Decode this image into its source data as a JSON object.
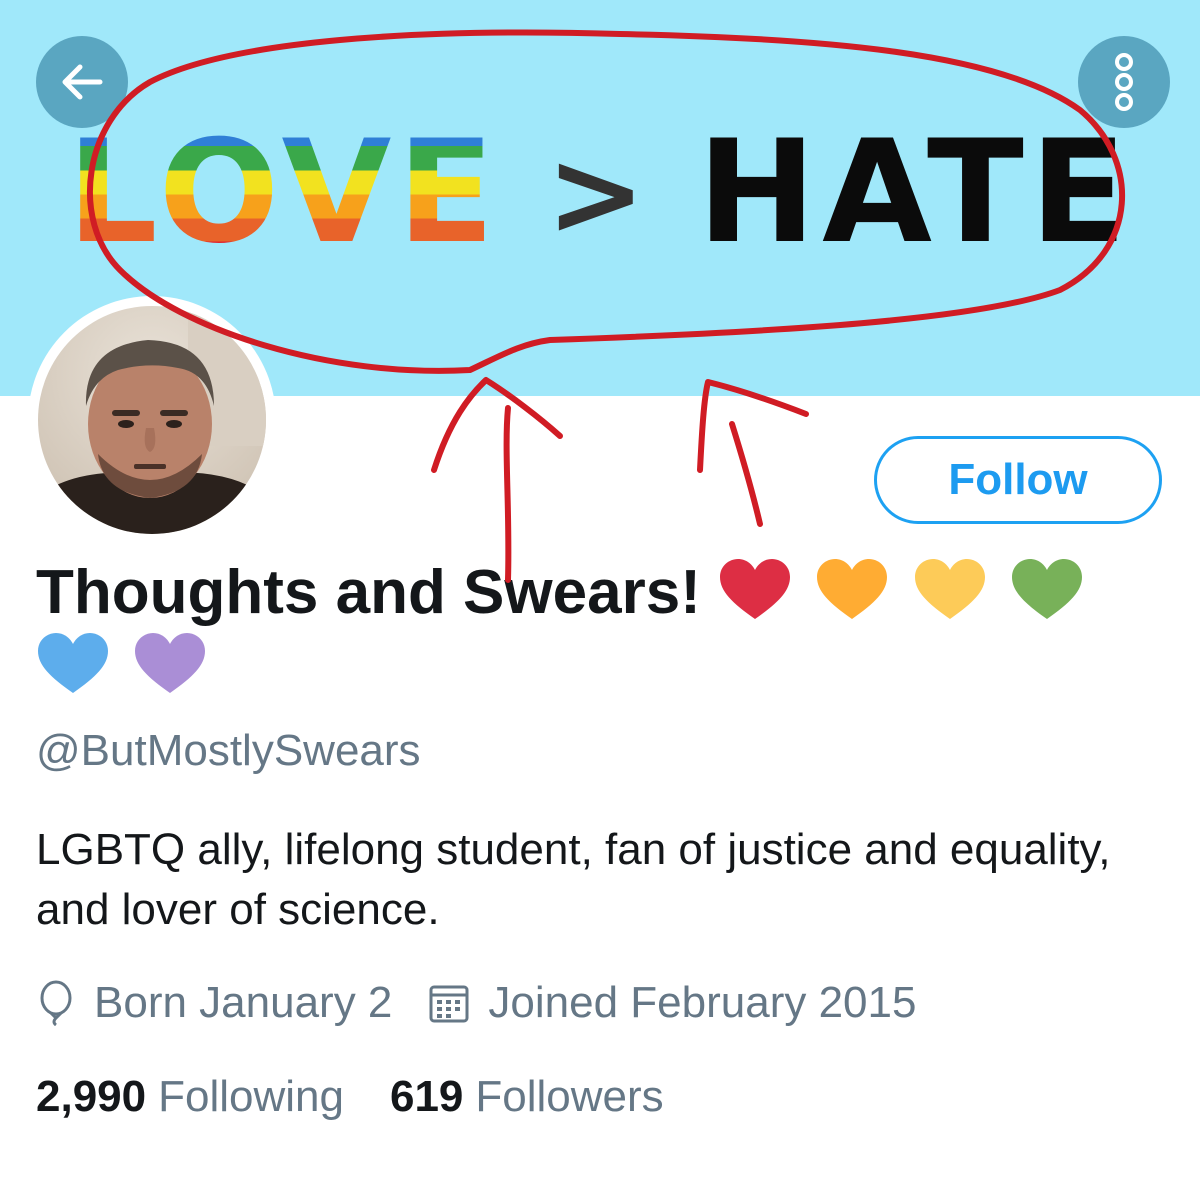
{
  "banner": {
    "word_love": "LOVE",
    "symbol": ">",
    "word_hate": "HATE",
    "background": "#a0e8fa"
  },
  "nav": {
    "back_icon": "arrow-left-icon",
    "more_icon": "more-vertical-icon"
  },
  "annotation": {
    "color": "#d01c24",
    "shapes": [
      "ellipse-around-banner-text",
      "arrow",
      "arrow"
    ]
  },
  "profile": {
    "follow_label": "Follow",
    "display_name": "Thoughts and Swears!",
    "name_hearts": [
      "#dd2e44",
      "#ffac33",
      "#fdcb58",
      "#78b159",
      "#5dadec",
      "#aa8ed6"
    ],
    "handle": "@ButMostlySwears",
    "bio": "LGBTQ ally, lifelong student, fan of justice and equality, and lover of science.",
    "birthday": "Born January 2",
    "joined": "Joined February 2015",
    "following_count": "2,990",
    "following_label": "Following",
    "followers_count": "619",
    "followers_label": "Followers"
  },
  "colors": {
    "accent": "#1da1f2",
    "secondary_text": "#657786",
    "primary_text": "#14171a"
  }
}
